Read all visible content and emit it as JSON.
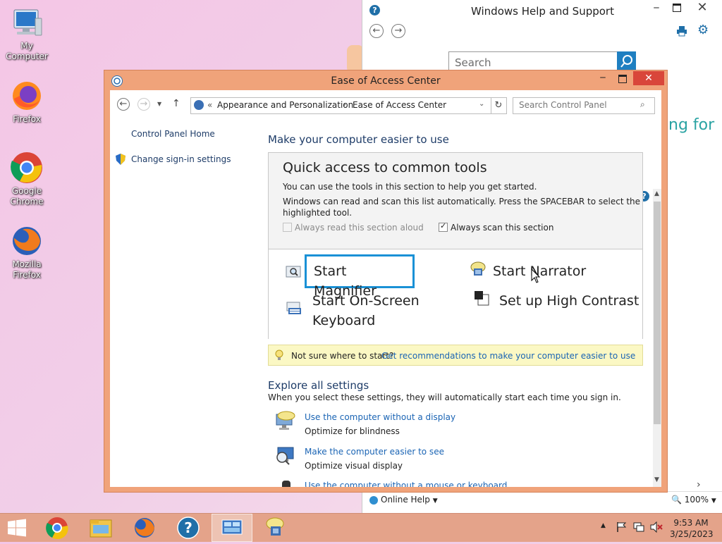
{
  "desktop": {
    "icons": [
      {
        "label": "My Computer"
      },
      {
        "label": "Firefox"
      },
      {
        "label": "Google Chrome"
      },
      {
        "label": "Mozilla Firefox"
      }
    ]
  },
  "help_window": {
    "title": "Windows Help and Support",
    "search_placeholder": "Search",
    "bg_heading": "ng for",
    "online_help": "Online Help",
    "zoom": "100%"
  },
  "eoa_window": {
    "title": "Ease of Access Center",
    "breadcrumb": [
      "Appearance and Personalization",
      "Ease of Access Center"
    ],
    "search_placeholder": "Search Control Panel",
    "sidebar": {
      "home": "Control Panel Home",
      "signin": "Change sign-in settings"
    },
    "heading": "Make your computer easier to use",
    "quick_access": {
      "title": "Quick access to common tools",
      "desc1": "You can use the tools in this section to help you get started.",
      "desc2a": "Windows can read and scan this list automatically.  Press the SPACEBAR to select the",
      "desc2b": "highlighted tool.",
      "always_read": "Always read this section aloud",
      "always_scan": "Always scan this section",
      "always_read_checked": false,
      "always_scan_checked": true,
      "tools": {
        "magnifier": "Start Magnifier",
        "narrator": "Start Narrator",
        "keyboard_line1": "Start On-Screen",
        "keyboard_line2": "Keyboard",
        "contrast": "Set up High Contrast"
      }
    },
    "tip": {
      "text": "Not sure where to start?",
      "link": "Get recommendations to make your computer easier to use"
    },
    "explore": {
      "title": "Explore all settings",
      "desc": "When you select these settings, they will automatically start each time you sign in.",
      "items": [
        {
          "link": "Use the computer without a display",
          "sub": "Optimize for blindness"
        },
        {
          "link": "Make the computer easier to see",
          "sub": "Optimize visual display"
        },
        {
          "link": "Use the computer without a mouse or keyboard",
          "sub": ""
        }
      ]
    }
  },
  "taskbar": {
    "time": "9:53 AM",
    "date": "3/25/2023"
  },
  "colors": {
    "window_frame": "#f0a37a",
    "taskbar": "#e4a38a",
    "link": "#1a64b4",
    "accent_blue": "#1f7fc1"
  }
}
